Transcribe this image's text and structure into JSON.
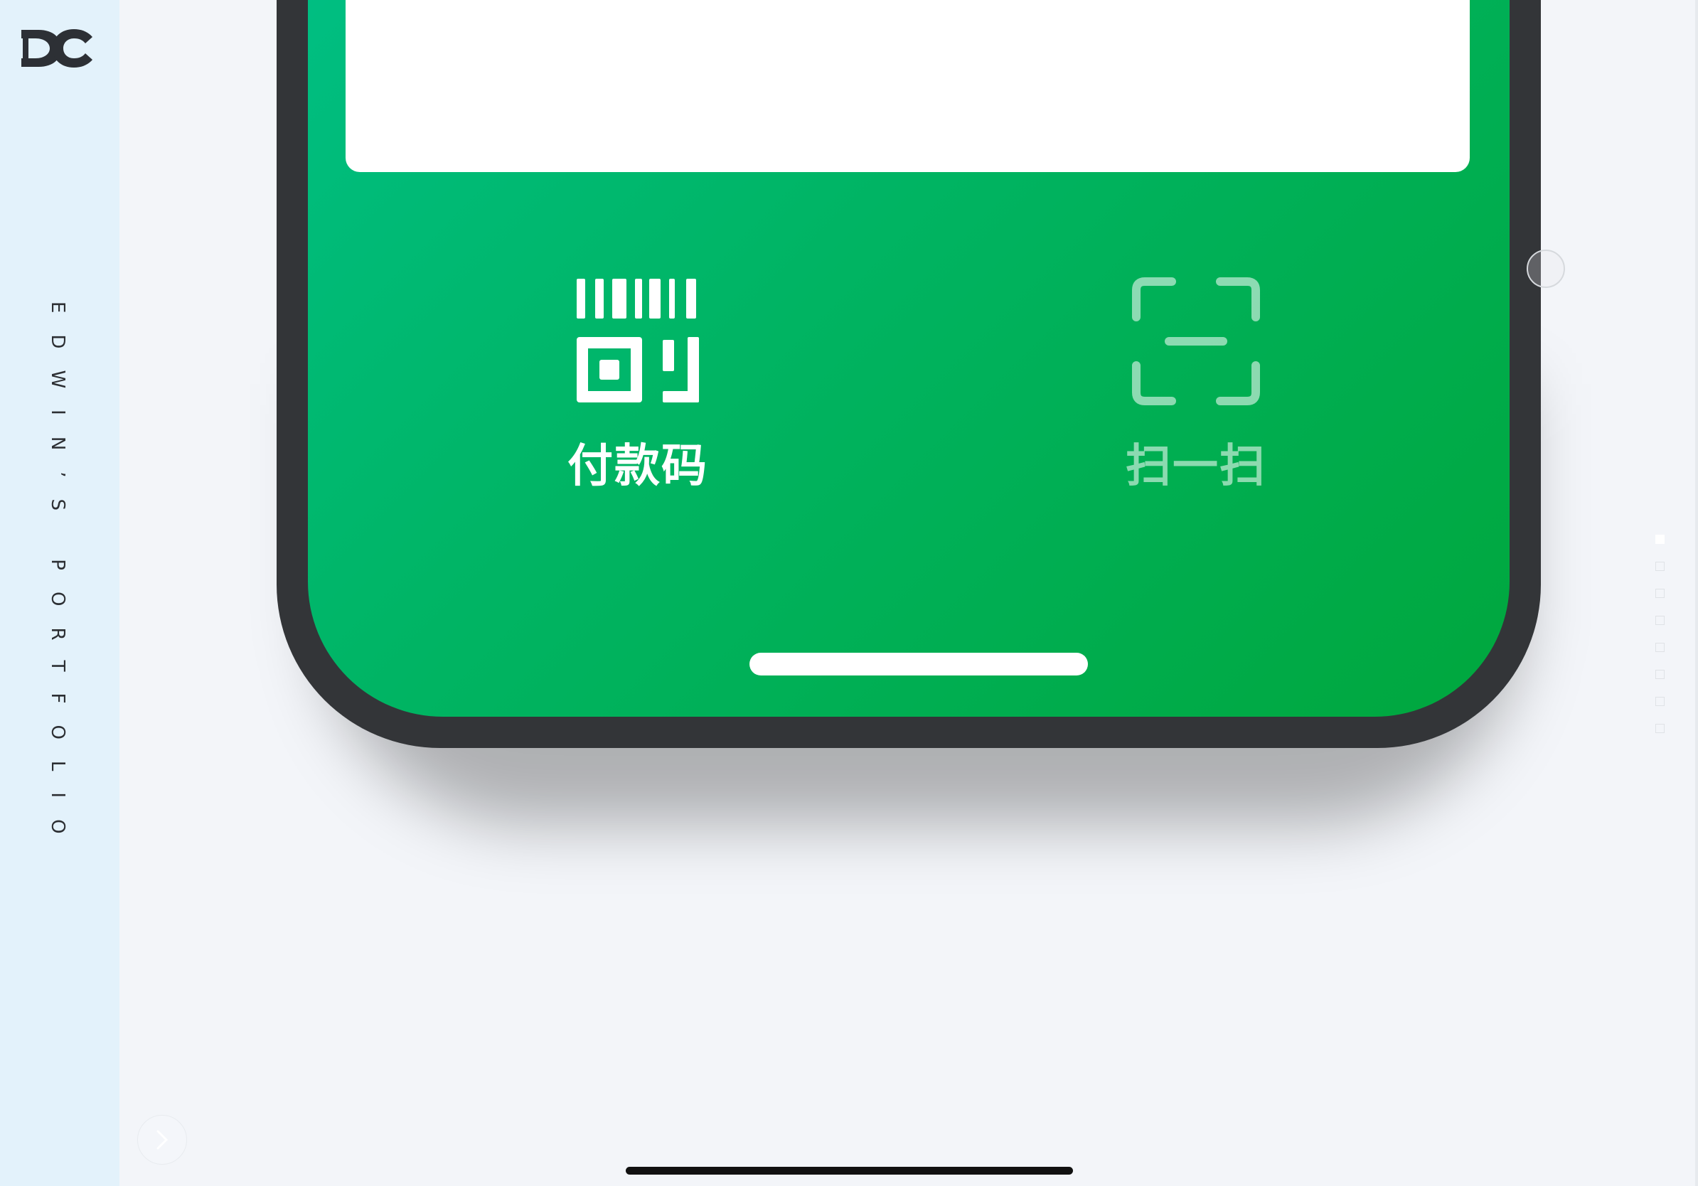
{
  "sidebar": {
    "logo_text": "DC",
    "vertical_title": "EDWIN’S PORTFOLIO"
  },
  "phone": {
    "actions": [
      {
        "label": "付款码",
        "icon": "payment-code-icon"
      },
      {
        "label": "扫一扫",
        "icon": "scan-icon"
      }
    ]
  },
  "pagination": {
    "total": 8,
    "active_index": 0
  },
  "colors": {
    "sidebar_bg": "#e3f2fb",
    "page_bg": "#f3f5f9",
    "phone_frame": "#333538",
    "screen_gradient_start": "#00c087",
    "screen_gradient_end": "#00a73d"
  }
}
